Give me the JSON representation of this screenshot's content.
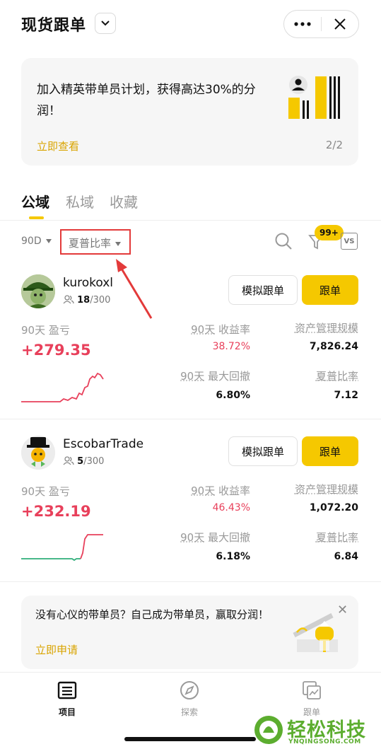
{
  "header": {
    "title": "现货跟单"
  },
  "banner": {
    "text": "加入精英带单员计划，获得高达30%的分润！",
    "link": "立即查看",
    "page": "2/2"
  },
  "tabs": [
    {
      "label": "公域",
      "active": true
    },
    {
      "label": "私域",
      "active": false
    },
    {
      "label": "收藏",
      "active": false
    }
  ],
  "filters": {
    "period": "90D",
    "sort": "夏普比率",
    "badge": "99+",
    "compare_label": "VS"
  },
  "labels": {
    "pnl_90d": "90天 盈亏",
    "roi_prefix": "90天",
    "roi": "收益率",
    "aum": "资产管理规模",
    "mdd_prefix": "90天",
    "mdd": "最大回撤",
    "sharpe": "夏普比率",
    "sim_button": "模拟跟单",
    "follow_button": "跟单"
  },
  "traders": [
    {
      "name": "kurokoxl",
      "followers": "18",
      "max_followers": "/300",
      "pnl": "+279.35",
      "roi": "38.72%",
      "aum": "7,826.24",
      "mdd": "6.80%",
      "sharpe": "7.12"
    },
    {
      "name": "EscobarTrade",
      "followers": "5",
      "max_followers": "/300",
      "pnl": "+232.19",
      "roi": "46.43%",
      "aum": "1,072.20",
      "mdd": "6.18%",
      "sharpe": "6.84"
    }
  ],
  "promo": {
    "text": "没有心仪的带单员？自己成为带单员，赢取分润！",
    "link": "立即申请"
  },
  "nav": [
    {
      "label": "项目",
      "active": true
    },
    {
      "label": "探索",
      "active": false
    },
    {
      "label": "跟单",
      "active": false
    }
  ],
  "watermark": {
    "main": "轻松科技",
    "sub": "YNQINGSONG.COM"
  },
  "colors": {
    "accent": "#f5c800",
    "profit": "#e8405b",
    "link": "#d9a400",
    "highlight_box": "#e33a3a"
  }
}
